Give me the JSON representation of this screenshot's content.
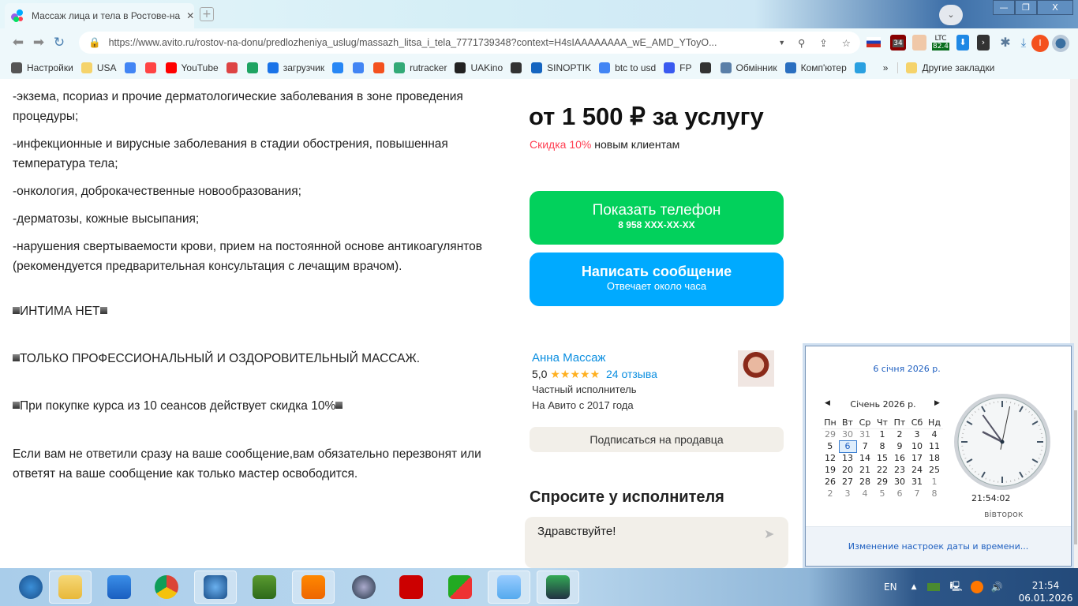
{
  "browser": {
    "tab_title": "Массаж лица и тела в Ростове-на",
    "url": "https://www.avito.ru/rostov-na-donu/predlozheniya_uslug/massazh_litsa_i_tela_7771739348?context=H4sIAAAAAAAA_wE_AMD_YToyO...",
    "ext_badge_count": "34",
    "ltc_label": "LTC",
    "ltc_value": "82.4",
    "profile_initial": "I"
  },
  "bookmarks": [
    {
      "label": "Настройки",
      "icon": "gear-icon",
      "color": "#555"
    },
    {
      "label": "USA",
      "icon": "folder-icon",
      "color": "#f5d36b"
    },
    {
      "label": "",
      "icon": "google-icon",
      "color": "#4285f4"
    },
    {
      "label": "",
      "icon": "yandex-icon",
      "color": "#f44"
    },
    {
      "label": "YouTube",
      "icon": "youtube-icon",
      "color": "#f00"
    },
    {
      "label": "",
      "icon": "gmail-icon",
      "color": "#d44"
    },
    {
      "label": "",
      "icon": "drive-icon",
      "color": "#1fa463"
    },
    {
      "label": "загрузчик",
      "icon": "infinity-icon",
      "color": "#1a73e8"
    },
    {
      "label": "",
      "icon": "vk-icon",
      "color": "#2787f5"
    },
    {
      "label": "",
      "icon": "translate-icon",
      "color": "#4285f4"
    },
    {
      "label": "",
      "icon": "f-icon",
      "color": "#f4511e"
    },
    {
      "label": "rutracker",
      "icon": "star-icon",
      "color": "#3a7"
    },
    {
      "label": "UAKino",
      "icon": "film-icon",
      "color": "#222"
    },
    {
      "label": "",
      "icon": "chess-icon",
      "color": "#333"
    },
    {
      "label": "SINOPTIK",
      "icon": "thermometer-icon",
      "color": "#1565c0"
    },
    {
      "label": "btc to usd",
      "icon": "google-icon",
      "color": "#4285f4"
    },
    {
      "label": "FP",
      "icon": "fp-icon",
      "color": "#3a5af0"
    },
    {
      "label": "",
      "icon": "bc-icon",
      "color": "#333"
    },
    {
      "label": "Обмінник",
      "icon": "exchange-icon",
      "color": "#5a7fa8"
    },
    {
      "label": "Комп'ютер",
      "icon": "globe-icon",
      "color": "#2a6fc0"
    },
    {
      "label": "",
      "icon": "asterisk-icon",
      "color": "#2aa0e0"
    }
  ],
  "bookmarks_more": "»",
  "other_bookmarks": "Другие закладки",
  "description": {
    "paragraphs": [
      "-экзема, псориаз и прочие дерматологические заболевания в зоне проведения процедуры;",
      "-инфекционные и вирусные заболевания в стадии обострения, повышенная температура тела;",
      "-онкология, доброкачественные новообразования;",
      "-дерматозы, кожные высыпания;",
      "-нарушения свертываемости крови, прием на постоянной основе антикоагулянтов (рекомендуется предварительная консультация с лечащим врачом)."
    ],
    "intim": "ИНТИМА НЕТ",
    "professional": "ТОЛЬКО ПРОФЕССИОНАЛЬНЫЙ И ОЗДОРОВИТЕЛЬНЫЙ МАССАЖ.",
    "course": "При покупке курса из 10 сеансов действует скидка 10%",
    "callback": "Если вам не ответили сразу на ваше сообщение,вам обязательно перезвонят или ответят на ваше сообщение как только мастер освободится."
  },
  "offer": {
    "price": "от 1 500 ₽ за услугу",
    "discount_highlight": "Скидка 10%",
    "discount_rest": " новым клиентам",
    "phone_label": "Показать телефон",
    "phone_number": "8 958 XXX-XX-XX",
    "message_label": "Написать сообщение",
    "message_sub": "Отвечает около часа",
    "colors": {
      "phone": "#02d15c",
      "message": "#00aaff",
      "discount": "#ff4053"
    }
  },
  "seller": {
    "name": "Анна Массаж",
    "rating": "5,0",
    "stars": 5,
    "reviews": "24 отзыва",
    "type": "Частный исполнитель",
    "since": "На Авито с 2017 года",
    "subscribe": "Подписаться на продавца"
  },
  "ask": {
    "title": "Спросите у исполнителя",
    "message": "Здравствуйте!"
  },
  "calendar": {
    "full_date": "6 січня 2026 р.",
    "month": "Січень 2026 р.",
    "weekdays": [
      "Пн",
      "Вт",
      "Ср",
      "Чт",
      "Пт",
      "Сб",
      "Нд"
    ],
    "weeks": [
      [
        "29",
        "30",
        "31",
        "1",
        "2",
        "3",
        "4"
      ],
      [
        "5",
        "6",
        "7",
        "8",
        "9",
        "10",
        "11"
      ],
      [
        "12",
        "13",
        "14",
        "15",
        "16",
        "17",
        "18"
      ],
      [
        "19",
        "20",
        "21",
        "22",
        "23",
        "24",
        "25"
      ],
      [
        "26",
        "27",
        "28",
        "29",
        "30",
        "31",
        "1"
      ],
      [
        "2",
        "3",
        "4",
        "5",
        "6",
        "7",
        "8"
      ]
    ],
    "today": "6",
    "time": "21:54:02",
    "weekday": "вівторок",
    "settings_link": "Изменение настроек даты и времени..."
  },
  "taskbar": {
    "lang": "EN",
    "time": "21:54",
    "date": "06.01.2026",
    "apps": [
      {
        "icon": "windows-start-icon"
      },
      {
        "icon": "explorer-icon"
      },
      {
        "icon": "wise-care-icon"
      },
      {
        "icon": "chrome-icon"
      },
      {
        "icon": "globe-browser-icon"
      },
      {
        "icon": "memory-icon"
      },
      {
        "icon": "media-player-icon"
      },
      {
        "icon": "clock-gadget-icon"
      },
      {
        "icon": "aida64-icon"
      },
      {
        "icon": "fastone-icon"
      },
      {
        "icon": "notepad-icon"
      },
      {
        "icon": "task-manager-icon"
      }
    ]
  }
}
